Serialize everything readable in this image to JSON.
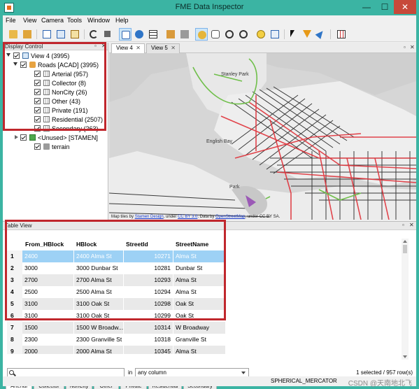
{
  "window": {
    "title": "FME Data Inspector",
    "min_glyph": "—",
    "max_glyph": "☐",
    "close_glyph": "✕",
    "accent": "#3bb4a3"
  },
  "menu": [
    "File",
    "View",
    "Camera",
    "Tools",
    "Window",
    "Help"
  ],
  "toolbar_icons": [
    "open-folder-icon",
    "save-icon",
    "copy-view-icon",
    "copy-icon",
    "refresh-icon",
    "stop-icon",
    "select-icon",
    "layers-icon",
    "table-icon",
    "book-icon",
    "cube-icon",
    "cursor-mode-icon",
    "pan-hand-icon",
    "zoom-in-icon",
    "zoom-out-icon",
    "info-icon",
    "zoom-extents-icon",
    "select-arrow-icon",
    "filter-icon",
    "navigate-icon",
    "grid-view-icon"
  ],
  "display_control": {
    "title": "Display Control",
    "view": "View 4 (3995)",
    "roads": "Roads [ACAD] (3995)",
    "layers": [
      "Arterial (957)",
      "Collector (8)",
      "NonCity (26)",
      "Other (43)",
      "Private (191)",
      "Residential (2507)",
      "Secondary (263)"
    ],
    "unused": "<Unused> [STAMEN]",
    "terrain": "terrain"
  },
  "views": {
    "tabs": [
      "View 4",
      "View 5"
    ],
    "active": "View 4",
    "close_glyph": "✕"
  },
  "map": {
    "labels": [
      "Stanley Park",
      "English Bay",
      "Park"
    ],
    "attr_prefix": "Map tiles by ",
    "attr_link1": "Stamen Design",
    "attr_mid": ", under ",
    "attr_link2": "CC BY 3.0",
    "attr_suffix": ". Data by ",
    "attr_link3": "OpenStreetMap",
    "attr_end": ", under CC BY SA."
  },
  "table_view": {
    "title": "Table View",
    "columns": [
      "From_HBlock",
      "HBlock",
      "StreetId",
      "StreetName"
    ],
    "rows": [
      {
        "n": "1",
        "from": "2400",
        "hblock": "2400 Alma St",
        "id": "10271",
        "name": "Alma St"
      },
      {
        "n": "2",
        "from": "3000",
        "hblock": "3000 Dunbar St",
        "id": "10281",
        "name": "Dunbar St"
      },
      {
        "n": "3",
        "from": "2700",
        "hblock": "2700 Alma St",
        "id": "10293",
        "name": "Alma St"
      },
      {
        "n": "4",
        "from": "2500",
        "hblock": "2500 Alma St",
        "id": "10294",
        "name": "Alma St"
      },
      {
        "n": "5",
        "from": "3100",
        "hblock": "3100 Oak St",
        "id": "10298",
        "name": "Oak St"
      },
      {
        "n": "6",
        "from": "3100",
        "hblock": "3100 Oak St",
        "id": "10299",
        "name": "Oak St"
      },
      {
        "n": "7",
        "from": "1500",
        "hblock": "1500 W Broadw...",
        "id": "10314",
        "name": "W Broadway"
      },
      {
        "n": "8",
        "from": "2300",
        "hblock": "2300 Granville St",
        "id": "10318",
        "name": "Granville St"
      },
      {
        "n": "9",
        "from": "2000",
        "hblock": "2000 Alma St",
        "id": "10345",
        "name": "Alma St"
      }
    ],
    "search_value": "",
    "in_label": "in",
    "column_select": "any column",
    "selection_status": "1 selected / 957 row(s)",
    "bottom_tabs": [
      "Arterial",
      "Collector",
      "NonCity",
      "Other",
      "Private",
      "Residential",
      "Secondary"
    ],
    "active_bottom_tab": "Arterial"
  },
  "status": {
    "projection": "SPHERICAL_MERCATOR",
    "watermark": "CSDN @天南地北飞"
  },
  "colors": {
    "highlight_box": "#c0272d",
    "selection": "#9dd1f5",
    "road_red": "#e0323a",
    "road_black": "#1a1a1a",
    "park_green": "#6fbf4a"
  }
}
